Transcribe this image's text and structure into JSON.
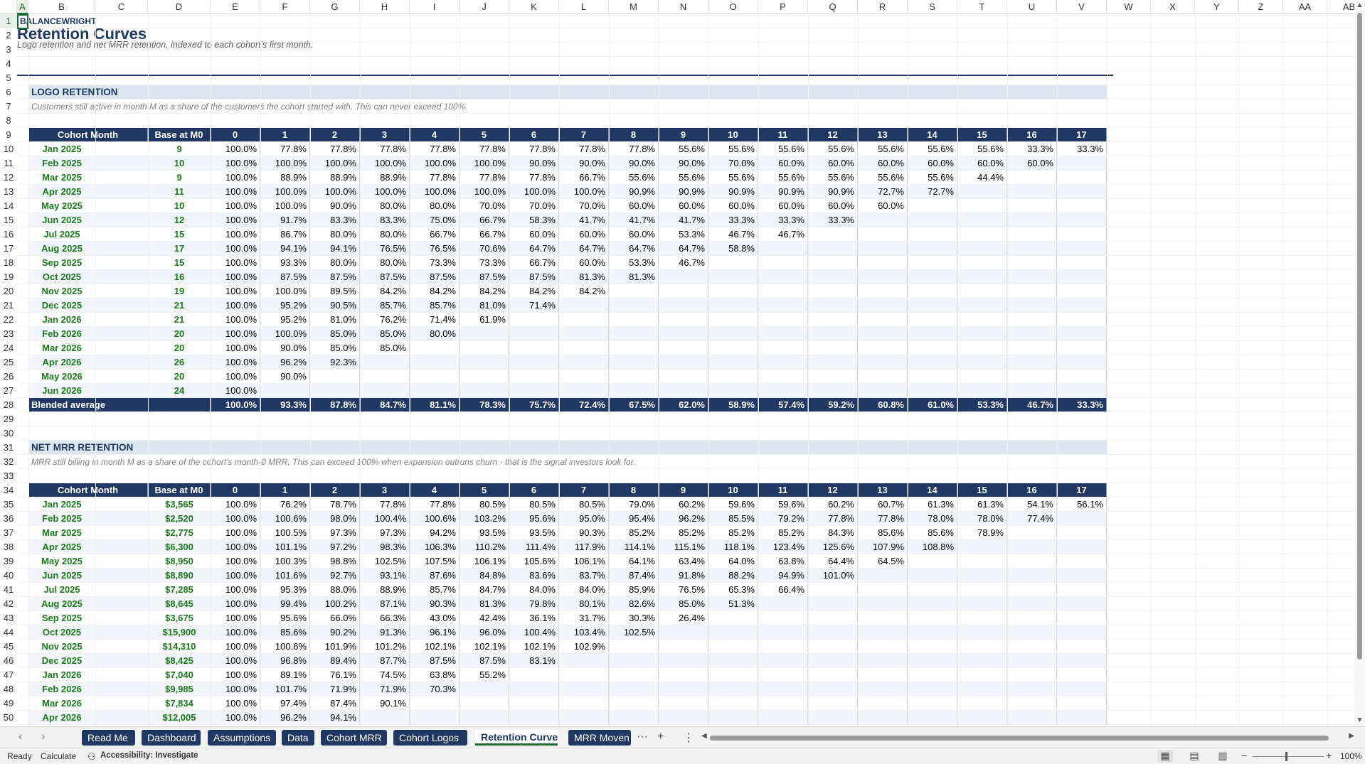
{
  "columns": [
    "A",
    "B",
    "C",
    "D",
    "E",
    "F",
    "G",
    "H",
    "I",
    "J",
    "K",
    "L",
    "M",
    "N",
    "O",
    "P",
    "Q",
    "R",
    "S",
    "T",
    "U",
    "V",
    "W",
    "X",
    "Y",
    "Z",
    "AA",
    "AB"
  ],
  "selected_cell": "A1",
  "sheet": {
    "brand": "BALANCEWRIGHT",
    "title": "Retention Curves",
    "subtitle": "Logo retention and net MRR retention, indexed to each cohort's first month."
  },
  "header_labels": {
    "cohort_month": "Cohort Month",
    "base": "Base at M0",
    "avg": "Blended average"
  },
  "month_indices": [
    "0",
    "1",
    "2",
    "3",
    "4",
    "5",
    "6",
    "7",
    "8",
    "9",
    "10",
    "11",
    "12",
    "13",
    "14",
    "15",
    "16",
    "17"
  ],
  "logo": {
    "section_title": "LOGO RETENTION",
    "note": "Customers still active in month M as a share of the customers the cohort started with. This can never exceed 100%.",
    "rows": [
      {
        "month": "Jan 2025",
        "base": "9",
        "values": [
          "100.0%",
          "77.8%",
          "77.8%",
          "77.8%",
          "77.8%",
          "77.8%",
          "77.8%",
          "77.8%",
          "77.8%",
          "55.6%",
          "55.6%",
          "55.6%",
          "55.6%",
          "55.6%",
          "55.6%",
          "55.6%",
          "33.3%",
          "33.3%"
        ]
      },
      {
        "month": "Feb 2025",
        "base": "10",
        "values": [
          "100.0%",
          "100.0%",
          "100.0%",
          "100.0%",
          "100.0%",
          "100.0%",
          "90.0%",
          "90.0%",
          "90.0%",
          "90.0%",
          "70.0%",
          "60.0%",
          "60.0%",
          "60.0%",
          "60.0%",
          "60.0%",
          "60.0%"
        ]
      },
      {
        "month": "Mar 2025",
        "base": "9",
        "values": [
          "100.0%",
          "88.9%",
          "88.9%",
          "88.9%",
          "77.8%",
          "77.8%",
          "77.8%",
          "66.7%",
          "55.6%",
          "55.6%",
          "55.6%",
          "55.6%",
          "55.6%",
          "55.6%",
          "55.6%",
          "44.4%"
        ]
      },
      {
        "month": "Apr 2025",
        "base": "11",
        "values": [
          "100.0%",
          "100.0%",
          "100.0%",
          "100.0%",
          "100.0%",
          "100.0%",
          "100.0%",
          "100.0%",
          "90.9%",
          "90.9%",
          "90.9%",
          "90.9%",
          "90.9%",
          "72.7%",
          "72.7%"
        ]
      },
      {
        "month": "May 2025",
        "base": "10",
        "values": [
          "100.0%",
          "100.0%",
          "90.0%",
          "80.0%",
          "80.0%",
          "70.0%",
          "70.0%",
          "70.0%",
          "60.0%",
          "60.0%",
          "60.0%",
          "60.0%",
          "60.0%",
          "60.0%"
        ]
      },
      {
        "month": "Jun 2025",
        "base": "12",
        "values": [
          "100.0%",
          "91.7%",
          "83.3%",
          "83.3%",
          "75.0%",
          "66.7%",
          "58.3%",
          "41.7%",
          "41.7%",
          "41.7%",
          "33.3%",
          "33.3%",
          "33.3%"
        ]
      },
      {
        "month": "Jul 2025",
        "base": "15",
        "values": [
          "100.0%",
          "86.7%",
          "80.0%",
          "80.0%",
          "66.7%",
          "66.7%",
          "60.0%",
          "60.0%",
          "60.0%",
          "53.3%",
          "46.7%",
          "46.7%"
        ]
      },
      {
        "month": "Aug 2025",
        "base": "17",
        "values": [
          "100.0%",
          "94.1%",
          "94.1%",
          "76.5%",
          "76.5%",
          "70.6%",
          "64.7%",
          "64.7%",
          "64.7%",
          "64.7%",
          "58.8%"
        ]
      },
      {
        "month": "Sep 2025",
        "base": "15",
        "values": [
          "100.0%",
          "93.3%",
          "80.0%",
          "80.0%",
          "73.3%",
          "73.3%",
          "66.7%",
          "60.0%",
          "53.3%",
          "46.7%"
        ]
      },
      {
        "month": "Oct 2025",
        "base": "16",
        "values": [
          "100.0%",
          "87.5%",
          "87.5%",
          "87.5%",
          "87.5%",
          "87.5%",
          "87.5%",
          "81.3%",
          "81.3%"
        ]
      },
      {
        "month": "Nov 2025",
        "base": "19",
        "values": [
          "100.0%",
          "100.0%",
          "89.5%",
          "84.2%",
          "84.2%",
          "84.2%",
          "84.2%",
          "84.2%"
        ]
      },
      {
        "month": "Dec 2025",
        "base": "21",
        "values": [
          "100.0%",
          "95.2%",
          "90.5%",
          "85.7%",
          "85.7%",
          "81.0%",
          "71.4%"
        ]
      },
      {
        "month": "Jan 2026",
        "base": "21",
        "values": [
          "100.0%",
          "95.2%",
          "81.0%",
          "76.2%",
          "71.4%",
          "61.9%"
        ]
      },
      {
        "month": "Feb 2026",
        "base": "20",
        "values": [
          "100.0%",
          "100.0%",
          "85.0%",
          "85.0%",
          "80.0%"
        ]
      },
      {
        "month": "Mar 2026",
        "base": "20",
        "values": [
          "100.0%",
          "90.0%",
          "85.0%",
          "85.0%"
        ]
      },
      {
        "month": "Apr 2026",
        "base": "26",
        "values": [
          "100.0%",
          "96.2%",
          "92.3%"
        ]
      },
      {
        "month": "May 2026",
        "base": "20",
        "values": [
          "100.0%",
          "90.0%"
        ]
      },
      {
        "month": "Jun 2026",
        "base": "24",
        "values": [
          "100.0%"
        ]
      }
    ],
    "average": [
      "100.0%",
      "93.3%",
      "87.8%",
      "84.7%",
      "81.1%",
      "78.3%",
      "75.7%",
      "72.4%",
      "67.5%",
      "62.0%",
      "58.9%",
      "57.4%",
      "59.2%",
      "60.8%",
      "61.0%",
      "53.3%",
      "46.7%",
      "33.3%"
    ]
  },
  "mrr": {
    "section_title": "NET MRR RETENTION",
    "note": "MRR still billing in month M as a share of the cohort's month-0 MRR. This can exceed 100% when expansion outruns churn - that is the signal investors look for.",
    "rows": [
      {
        "month": "Jan 2025",
        "base": "$3,565",
        "values": [
          "100.0%",
          "76.2%",
          "78.7%",
          "77.8%",
          "77.8%",
          "80.5%",
          "80.5%",
          "80.5%",
          "79.0%",
          "60.2%",
          "59.6%",
          "59.6%",
          "60.2%",
          "60.7%",
          "61.3%",
          "61.3%",
          "54.1%",
          "56.1%"
        ]
      },
      {
        "month": "Feb 2025",
        "base": "$2,520",
        "values": [
          "100.0%",
          "100.6%",
          "98.0%",
          "100.4%",
          "100.6%",
          "103.2%",
          "95.6%",
          "95.0%",
          "95.4%",
          "96.2%",
          "85.5%",
          "79.2%",
          "77.8%",
          "77.8%",
          "78.0%",
          "78.0%",
          "77.4%"
        ]
      },
      {
        "month": "Mar 2025",
        "base": "$2,775",
        "values": [
          "100.0%",
          "100.5%",
          "97.3%",
          "97.3%",
          "94.2%",
          "93.5%",
          "93.5%",
          "90.3%",
          "85.2%",
          "85.2%",
          "85.2%",
          "85.2%",
          "84.3%",
          "85.6%",
          "85.6%",
          "78.9%"
        ]
      },
      {
        "month": "Apr 2025",
        "base": "$6,300",
        "values": [
          "100.0%",
          "101.1%",
          "97.2%",
          "98.3%",
          "106.3%",
          "110.2%",
          "111.4%",
          "117.9%",
          "114.1%",
          "115.1%",
          "118.1%",
          "123.4%",
          "125.6%",
          "107.9%",
          "108.8%"
        ]
      },
      {
        "month": "May 2025",
        "base": "$8,950",
        "values": [
          "100.0%",
          "100.3%",
          "98.8%",
          "102.5%",
          "107.5%",
          "106.1%",
          "105.6%",
          "106.1%",
          "64.1%",
          "63.4%",
          "64.0%",
          "63.8%",
          "64.4%",
          "64.5%"
        ]
      },
      {
        "month": "Jun 2025",
        "base": "$8,890",
        "values": [
          "100.0%",
          "101.6%",
          "92.7%",
          "93.1%",
          "87.6%",
          "84.8%",
          "83.6%",
          "83.7%",
          "87.4%",
          "91.8%",
          "88.2%",
          "94.9%",
          "101.0%"
        ]
      },
      {
        "month": "Jul 2025",
        "base": "$7,285",
        "values": [
          "100.0%",
          "95.3%",
          "88.0%",
          "88.9%",
          "85.7%",
          "84.7%",
          "84.0%",
          "84.0%",
          "85.9%",
          "76.5%",
          "65.3%",
          "66.4%"
        ]
      },
      {
        "month": "Aug 2025",
        "base": "$8,645",
        "values": [
          "100.0%",
          "99.4%",
          "100.2%",
          "87.1%",
          "90.3%",
          "81.3%",
          "79.8%",
          "80.1%",
          "82.6%",
          "85.0%",
          "51.3%"
        ]
      },
      {
        "month": "Sep 2025",
        "base": "$3,675",
        "values": [
          "100.0%",
          "95.6%",
          "66.0%",
          "66.3%",
          "43.0%",
          "42.4%",
          "36.1%",
          "31.7%",
          "30.3%",
          "26.4%"
        ]
      },
      {
        "month": "Oct 2025",
        "base": "$15,900",
        "values": [
          "100.0%",
          "85.6%",
          "90.2%",
          "91.3%",
          "96.1%",
          "96.0%",
          "100.4%",
          "103.4%",
          "102.5%"
        ]
      },
      {
        "month": "Nov 2025",
        "base": "$14,310",
        "values": [
          "100.0%",
          "100.6%",
          "101.9%",
          "101.2%",
          "102.1%",
          "102.1%",
          "102.1%",
          "102.9%"
        ]
      },
      {
        "month": "Dec 2025",
        "base": "$8,425",
        "values": [
          "100.0%",
          "96.8%",
          "89.4%",
          "87.7%",
          "87.5%",
          "87.5%",
          "83.1%"
        ]
      },
      {
        "month": "Jan 2026",
        "base": "$7,040",
        "values": [
          "100.0%",
          "89.1%",
          "76.1%",
          "74.5%",
          "63.8%",
          "55.2%"
        ]
      },
      {
        "month": "Feb 2026",
        "base": "$9,985",
        "values": [
          "100.0%",
          "101.7%",
          "71.9%",
          "71.9%",
          "70.3%"
        ]
      },
      {
        "month": "Mar 2026",
        "base": "$7,834",
        "values": [
          "100.0%",
          "97.4%",
          "87.4%",
          "90.1%"
        ]
      },
      {
        "month": "Apr 2026",
        "base": "$12,005",
        "values": [
          "100.0%",
          "96.2%",
          "94.1%"
        ]
      }
    ]
  },
  "tabs": [
    "Read Me",
    "Dashboard",
    "Assumptions",
    "Data",
    "Cohort MRR",
    "Cohort Logos",
    "Retention Curves",
    "MRR Moven"
  ],
  "active_tab": "Retention Curves",
  "tabbar_icons": {
    "prev": "‹",
    "next": "›",
    "more": "···",
    "add": "+",
    "menu": "⋮",
    "left": "◀",
    "right": "▶"
  },
  "status": {
    "ready": "Ready",
    "calculate": "Calculate",
    "accessibility": "Accessibility: Investigate",
    "zoom": "100%",
    "zoom_minus": "−",
    "zoom_plus": "+"
  }
}
